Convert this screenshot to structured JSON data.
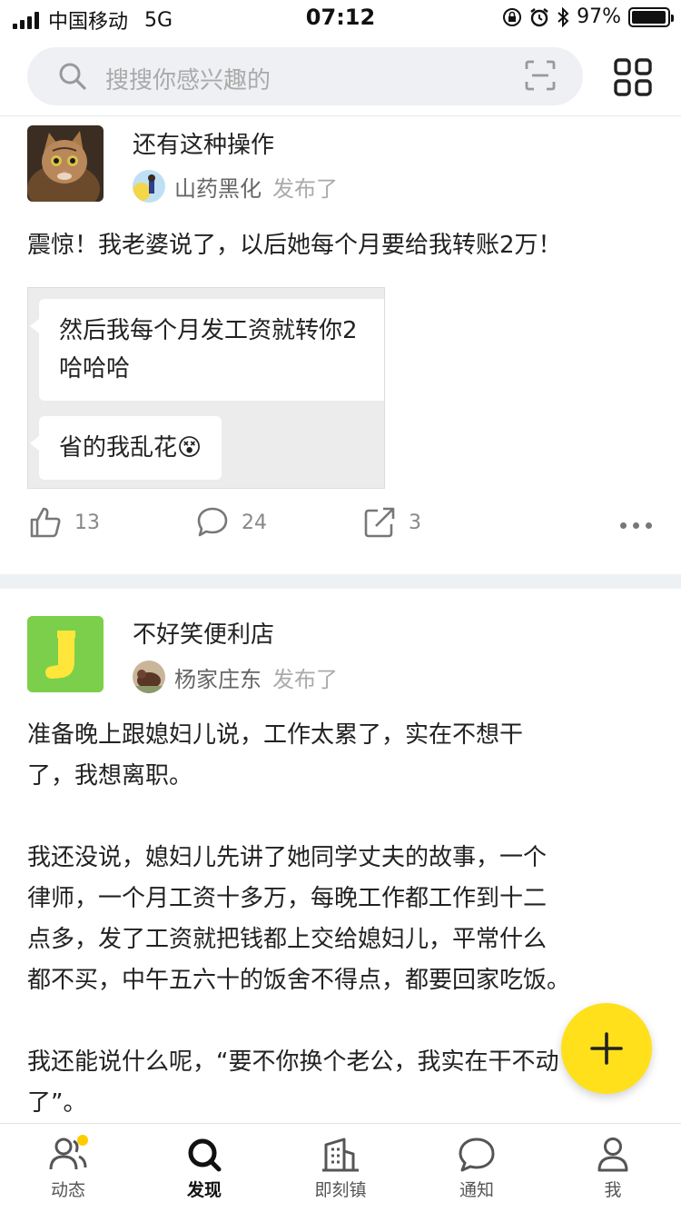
{
  "status_bar": {
    "carrier": "中国移动",
    "network": "5G",
    "time": "07:12",
    "battery": "97%",
    "battery_level": 0.97
  },
  "search": {
    "placeholder": "搜搜你感兴趣的"
  },
  "feed": [
    {
      "title": "还有这种操作",
      "author": "山药黑化",
      "verb": "发布了",
      "text": "震惊！我老婆说了，以后她每个月要给我转账2万！",
      "image_bubbles": [
        "然后我每个月发工资就转你2\n哈哈哈",
        "省的我乱花😵"
      ],
      "likes": "13",
      "comments": "24",
      "shares": "3"
    },
    {
      "title": "不好笑便利店",
      "author": "杨家庄东",
      "verb": "发布了",
      "text": "准备晚上跟媳妇儿说，工作太累了，实在不想干\n了，我想离职。\n\n我还没说，媳妇儿先讲了她同学丈夫的故事，一个\n律师，一个月工资十多万，每晚工作都工作到十二\n点多，发了工资就把钱都上交给媳妇儿，平常什么\n都不买，中午五六十的饭舍不得点，都要回家吃饭。\n\n我还能说什么呢，“要不你换个老公，我实在干不动\n了”。"
    }
  ],
  "tabs": [
    {
      "label": "动态",
      "icon": "users-icon"
    },
    {
      "label": "发现",
      "icon": "search-icon"
    },
    {
      "label": "即刻镇",
      "icon": "building-icon"
    },
    {
      "label": "通知",
      "icon": "chat-icon"
    },
    {
      "label": "我",
      "icon": "person-icon"
    }
  ],
  "colors": {
    "accent": "#ffe01b",
    "badge": "#ffcc00"
  }
}
